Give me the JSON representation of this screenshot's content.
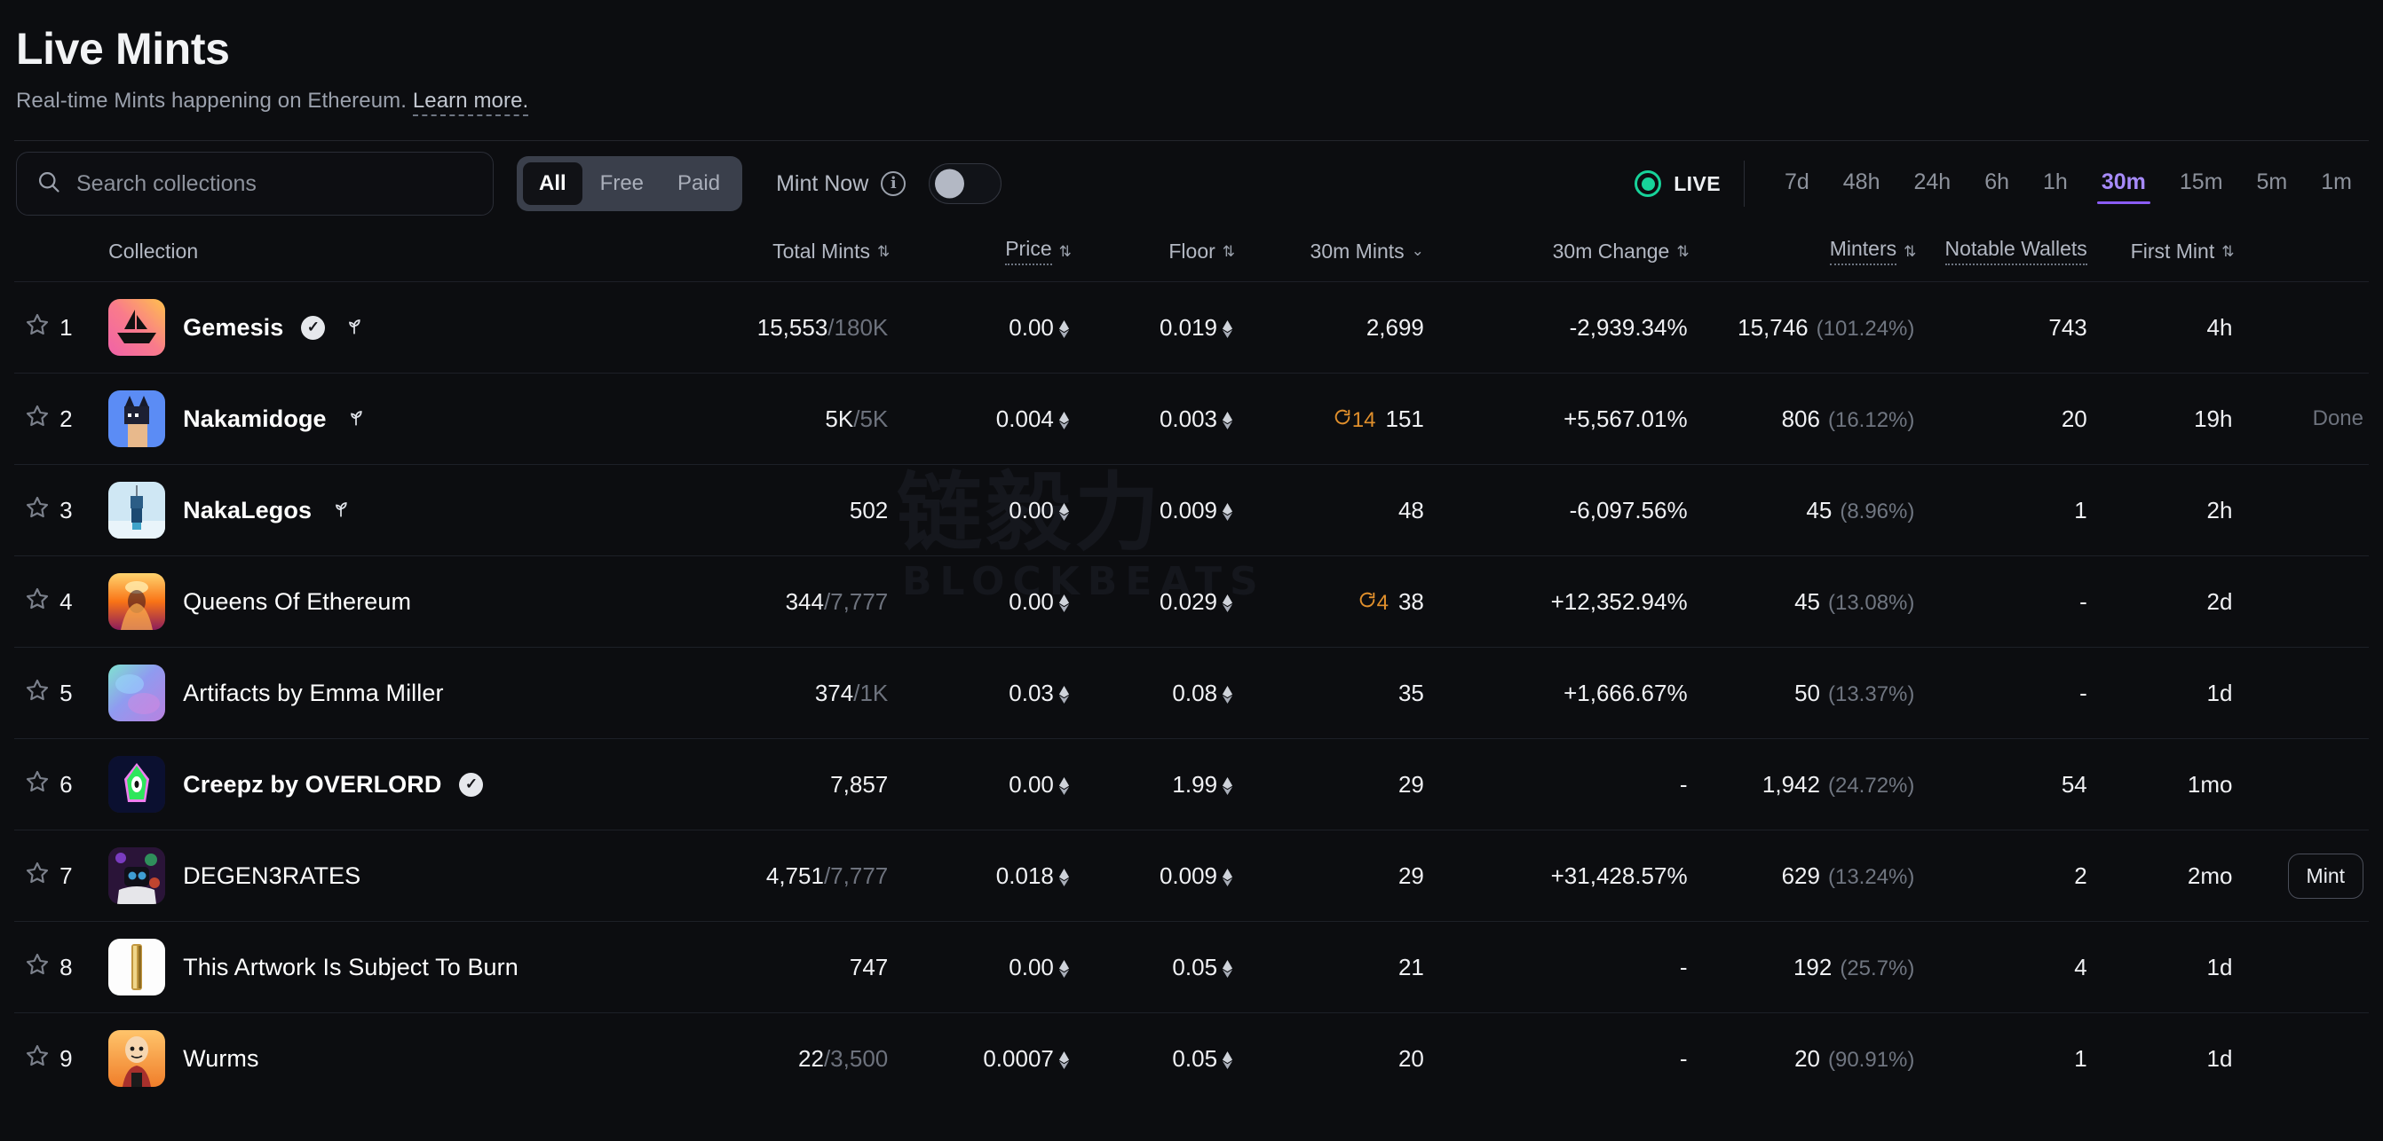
{
  "header": {
    "title": "Live Mints",
    "subtitle_prefix": "Real-time Mints happening on Ethereum. ",
    "learn_more": "Learn more."
  },
  "toolbar": {
    "search": {
      "placeholder": "Search collections",
      "value": "",
      "icon": "search-icon"
    },
    "segments": [
      {
        "label": "All",
        "active": true
      },
      {
        "label": "Free",
        "active": false
      },
      {
        "label": "Paid",
        "active": false
      }
    ],
    "mint_now": {
      "label": "Mint Now",
      "info_icon": "info-icon",
      "toggle_on": false
    },
    "live": {
      "label": "LIVE",
      "color": "#17d39a"
    },
    "ranges": [
      {
        "label": "7d",
        "active": false
      },
      {
        "label": "48h",
        "active": false
      },
      {
        "label": "24h",
        "active": false
      },
      {
        "label": "6h",
        "active": false
      },
      {
        "label": "1h",
        "active": false
      },
      {
        "label": "30m",
        "active": true
      },
      {
        "label": "15m",
        "active": false
      },
      {
        "label": "5m",
        "active": false
      },
      {
        "label": "1m",
        "active": false
      }
    ],
    "accent": "#8b5cf6"
  },
  "watermark": {
    "line1": "链毅力",
    "line2": "BLOCKBEATS"
  },
  "table": {
    "columns": [
      {
        "key": "collection",
        "label": "Collection",
        "sort": false,
        "dotted": false,
        "chevron": false
      },
      {
        "key": "total_mints",
        "label": "Total Mints",
        "sort": true,
        "dotted": false,
        "chevron": false
      },
      {
        "key": "price",
        "label": "Price",
        "sort": true,
        "dotted": true,
        "chevron": false
      },
      {
        "key": "floor",
        "label": "Floor",
        "sort": true,
        "dotted": false,
        "chevron": false
      },
      {
        "key": "mints_30m",
        "label": "30m Mints",
        "sort": false,
        "dotted": false,
        "chevron": true
      },
      {
        "key": "change_30m",
        "label": "30m Change",
        "sort": true,
        "dotted": false,
        "chevron": false
      },
      {
        "key": "minters",
        "label": "Minters",
        "sort": true,
        "dotted": true,
        "chevron": false
      },
      {
        "key": "notable",
        "label": "Notable Wallets",
        "sort": false,
        "dotted": true,
        "chevron": false
      },
      {
        "key": "first_mint",
        "label": "First Mint",
        "sort": true,
        "dotted": false,
        "chevron": false
      }
    ],
    "rows": [
      {
        "rank": "1",
        "name": "Gemesis",
        "verified": true,
        "sprout": true,
        "avatar": "boat-gradient-icon",
        "total_mints": "15,553",
        "total_supply": "180K",
        "price": "0.00",
        "floor": "0.019",
        "mints_30m": "2,699",
        "refresh_count": "",
        "change_30m": "-2,939.34%",
        "change_dir": "neg",
        "minters": "15,746",
        "minters_pct": "(101.24%)",
        "notable": "743",
        "notable_link": true,
        "first_mint": "4h",
        "action": "",
        "action_type": ""
      },
      {
        "rank": "2",
        "name": "Nakamidoge",
        "verified": false,
        "sprout": true,
        "avatar": "nakamidoge-icon",
        "total_mints": "5K",
        "total_supply": "5K",
        "price": "0.004",
        "floor": "0.003",
        "mints_30m": "151",
        "refresh_count": "14",
        "change_30m": "+5,567.01%",
        "change_dir": "pos",
        "minters": "806",
        "minters_pct": "(16.12%)",
        "notable": "20",
        "notable_link": true,
        "first_mint": "19h",
        "action": "Done",
        "action_type": "done"
      },
      {
        "rank": "3",
        "name": "NakaLegos",
        "verified": false,
        "sprout": true,
        "avatar": "nakalegos-icon",
        "total_mints": "502",
        "total_supply": "",
        "price": "0.00",
        "floor": "0.009",
        "mints_30m": "48",
        "refresh_count": "",
        "change_30m": "-6,097.56%",
        "change_dir": "neg",
        "minters": "45",
        "minters_pct": "(8.96%)",
        "notable": "1",
        "notable_link": true,
        "first_mint": "2h",
        "action": "",
        "action_type": ""
      },
      {
        "rank": "4",
        "name": "Queens Of Ethereum",
        "verified": false,
        "sprout": false,
        "avatar": "queens-icon",
        "total_mints": "344",
        "total_supply": "7,777",
        "price": "0.00",
        "floor": "0.029",
        "mints_30m": "38",
        "refresh_count": "4",
        "change_30m": "+12,352.94%",
        "change_dir": "pos",
        "minters": "45",
        "minters_pct": "(13.08%)",
        "notable": "-",
        "notable_link": false,
        "first_mint": "2d",
        "action": "",
        "action_type": ""
      },
      {
        "rank": "5",
        "name": "Artifacts by Emma Miller",
        "verified": false,
        "sprout": false,
        "avatar": "artifacts-icon",
        "total_mints": "374",
        "total_supply": "1K",
        "price": "0.03",
        "floor": "0.08",
        "mints_30m": "35",
        "refresh_count": "",
        "change_30m": "+1,666.67%",
        "change_dir": "pos",
        "minters": "50",
        "minters_pct": "(13.37%)",
        "notable": "-",
        "notable_link": false,
        "first_mint": "1d",
        "action": "",
        "action_type": ""
      },
      {
        "rank": "6",
        "name": "Creepz by OVERLORD",
        "verified": true,
        "sprout": false,
        "avatar": "creepz-icon",
        "total_mints": "7,857",
        "total_supply": "",
        "price": "0.00",
        "floor": "1.99",
        "mints_30m": "29",
        "refresh_count": "",
        "change_30m": "-",
        "change_dir": "none",
        "minters": "1,942",
        "minters_pct": "(24.72%)",
        "notable": "54",
        "notable_link": true,
        "first_mint": "1mo",
        "action": "",
        "action_type": ""
      },
      {
        "rank": "7",
        "name": "DEGEN3RATES",
        "verified": false,
        "sprout": false,
        "avatar": "degen3rates-icon",
        "total_mints": "4,751",
        "total_supply": "7,777",
        "price": "0.018",
        "floor": "0.009",
        "mints_30m": "29",
        "refresh_count": "",
        "change_30m": "+31,428.57%",
        "change_dir": "pos",
        "minters": "629",
        "minters_pct": "(13.24%)",
        "notable": "2",
        "notable_link": true,
        "first_mint": "2mo",
        "action": "Mint",
        "action_type": "mint"
      },
      {
        "rank": "8",
        "name": "This Artwork Is Subject To Burn",
        "verified": false,
        "sprout": false,
        "avatar": "burn-icon",
        "total_mints": "747",
        "total_supply": "",
        "price": "0.00",
        "floor": "0.05",
        "mints_30m": "21",
        "refresh_count": "",
        "change_30m": "-",
        "change_dir": "none",
        "minters": "192",
        "minters_pct": "(25.7%)",
        "notable": "4",
        "notable_link": true,
        "first_mint": "1d",
        "action": "",
        "action_type": ""
      },
      {
        "rank": "9",
        "name": "Wurms",
        "verified": false,
        "sprout": false,
        "avatar": "wurms-icon",
        "total_mints": "22",
        "total_supply": "3,500",
        "price": "0.0007",
        "floor": "0.05",
        "mints_30m": "20",
        "refresh_count": "",
        "change_30m": "-",
        "change_dir": "none",
        "minters": "20",
        "minters_pct": "(90.91%)",
        "notable": "1",
        "notable_link": true,
        "first_mint": "1d",
        "action": "",
        "action_type": ""
      }
    ]
  }
}
